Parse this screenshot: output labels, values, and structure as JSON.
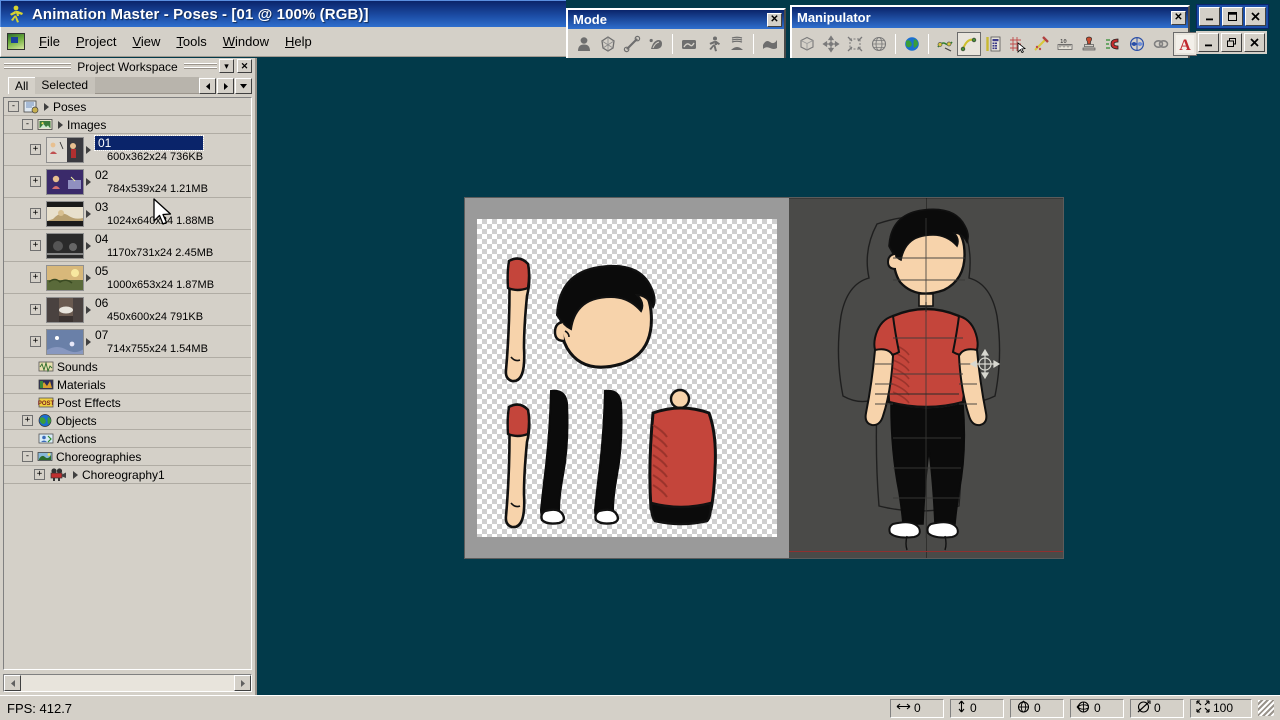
{
  "app": {
    "title": "Animation Master - Poses - [01 @ 100% (RGB)]",
    "logo_icon": "running-man-icon"
  },
  "menu": {
    "app_icon": "document-image-icon",
    "items": [
      {
        "label": "File",
        "mnemonic": "F"
      },
      {
        "label": "Project",
        "mnemonic": "P"
      },
      {
        "label": "View",
        "mnemonic": "V"
      },
      {
        "label": "Tools",
        "mnemonic": "T"
      },
      {
        "label": "Window",
        "mnemonic": "W"
      },
      {
        "label": "Help",
        "mnemonic": "H"
      }
    ]
  },
  "mode_palette": {
    "title": "Mode",
    "close_label": "✕",
    "buttons": [
      {
        "name": "modeling-mode-icon",
        "title": "Modeling"
      },
      {
        "name": "mesh-mode-icon",
        "title": "Mesh"
      },
      {
        "name": "bone-mode-icon",
        "title": "Bones"
      },
      {
        "name": "muscle-mode-icon",
        "title": "Muscle"
      },
      {
        "name": "action-mode-icon",
        "title": "Action"
      },
      {
        "name": "walk-mode-icon",
        "title": "Walk"
      },
      {
        "name": "spring-mode-icon",
        "title": "Dynamics"
      },
      {
        "name": "choreography-mode-icon",
        "title": "Choreography"
      }
    ]
  },
  "manipulator_palette": {
    "title": "Manipulator",
    "close_label": "✕",
    "buttons": [
      {
        "name": "bounding-box-icon",
        "selected": false
      },
      {
        "name": "translate-icon",
        "selected": false
      },
      {
        "name": "scale-icon",
        "selected": false
      },
      {
        "name": "rotate-globe-icon",
        "selected": false
      },
      {
        "name": "world-globe-icon",
        "selected": false
      },
      {
        "name": "group-edit-icon",
        "selected": false
      },
      {
        "name": "spline-edit-icon",
        "selected": true
      },
      {
        "name": "properties-icon",
        "selected": false
      },
      {
        "name": "grid-snap-icon",
        "selected": false
      },
      {
        "name": "magnet-snap-icon",
        "selected": false
      },
      {
        "name": "ruler-icon",
        "selected": false
      },
      {
        "name": "stamp-icon",
        "selected": false
      },
      {
        "name": "magnet-icon",
        "selected": false
      },
      {
        "name": "mirror-icon",
        "selected": false
      },
      {
        "name": "link-icon",
        "selected": false
      },
      {
        "name": "text-tool-icon",
        "selected": false
      }
    ]
  },
  "window_controls": {
    "outer": [
      {
        "name": "minimize-button",
        "glyph": "minimize"
      },
      {
        "name": "maximize-button",
        "glyph": "maximize"
      },
      {
        "name": "close-button",
        "glyph": "close"
      }
    ],
    "inner": [
      {
        "name": "minimize-button",
        "glyph": "minimize"
      },
      {
        "name": "restore-button",
        "glyph": "restore"
      },
      {
        "name": "close-button",
        "glyph": "close"
      }
    ]
  },
  "workspace": {
    "title": "Project Workspace",
    "menu_button_label": "▾",
    "close_button_label": "✕",
    "tabs": [
      {
        "label": "All",
        "active": true
      },
      {
        "label": "Selected",
        "active": false
      }
    ],
    "tab_nav": [
      {
        "name": "tab-prev-button",
        "glyph": "◄"
      },
      {
        "name": "tab-next-button",
        "glyph": "►"
      },
      {
        "name": "tab-menu-button",
        "glyph": "▼"
      }
    ],
    "tree": [
      {
        "label": "Poses",
        "indent": 0,
        "expander": "-",
        "arrow": true,
        "icon": "poses-folder-icon",
        "type": "folder",
        "selected": false
      },
      {
        "label": "Images",
        "indent": 1,
        "expander": "-",
        "arrow": true,
        "icon": "images-folder-icon",
        "type": "folder",
        "selected": false
      },
      {
        "label": "01",
        "indent": 2,
        "expander": "+",
        "arrow": true,
        "type": "image",
        "selected": true,
        "size": "600x362x24 736KB",
        "thumb": "thumb-01"
      },
      {
        "label": "02",
        "indent": 2,
        "expander": "+",
        "arrow": true,
        "type": "image",
        "selected": false,
        "size": "784x539x24 1.21MB",
        "thumb": "thumb-02"
      },
      {
        "label": "03",
        "indent": 2,
        "expander": "+",
        "arrow": true,
        "type": "image",
        "selected": false,
        "size": "1024x640x24 1.88MB",
        "thumb": "thumb-03"
      },
      {
        "label": "04",
        "indent": 2,
        "expander": "+",
        "arrow": true,
        "type": "image",
        "selected": false,
        "size": "1170x731x24 2.45MB",
        "thumb": "thumb-04"
      },
      {
        "label": "05",
        "indent": 2,
        "expander": "+",
        "arrow": true,
        "type": "image",
        "selected": false,
        "size": "1000x653x24 1.87MB",
        "thumb": "thumb-05"
      },
      {
        "label": "06",
        "indent": 2,
        "expander": "+",
        "arrow": true,
        "type": "image",
        "selected": false,
        "size": "450x600x24 791KB",
        "thumb": "thumb-06"
      },
      {
        "label": "07",
        "indent": 2,
        "expander": "+",
        "arrow": true,
        "type": "image",
        "selected": false,
        "size": "714x755x24 1.54MB",
        "thumb": "thumb-07"
      },
      {
        "label": "Sounds",
        "indent": 1,
        "expander": "",
        "arrow": false,
        "icon": "sounds-icon",
        "type": "folder",
        "selected": false
      },
      {
        "label": "Materials",
        "indent": 1,
        "expander": "",
        "arrow": false,
        "icon": "materials-icon",
        "type": "folder",
        "selected": false
      },
      {
        "label": "Post Effects",
        "indent": 1,
        "expander": "",
        "arrow": false,
        "icon": "post-effects-icon",
        "type": "folder",
        "selected": false
      },
      {
        "label": "Objects",
        "indent": 1,
        "expander": "+",
        "arrow": false,
        "icon": "objects-globe-icon",
        "type": "folder",
        "selected": false
      },
      {
        "label": "Actions",
        "indent": 1,
        "expander": "",
        "arrow": false,
        "icon": "actions-icon",
        "type": "folder",
        "selected": false
      },
      {
        "label": "Choreographies",
        "indent": 1,
        "expander": "-",
        "arrow": false,
        "icon": "choreographies-icon",
        "type": "folder",
        "selected": false
      },
      {
        "label": "Choreography1",
        "indent": 2,
        "expander": "+",
        "arrow": true,
        "icon": "camera-icon",
        "type": "folder",
        "selected": false
      }
    ],
    "hscroll": {
      "left_arrow": "◄",
      "right_arrow": "►"
    }
  },
  "document_window": {
    "zoom_label": "100%",
    "color_mode": "RGB",
    "left_canvas": {
      "name": "image-canvas-01",
      "background": "transparency-checkerboard",
      "parts": [
        "right-arm",
        "head",
        "left-arm",
        "right-leg",
        "left-leg",
        "torso"
      ]
    },
    "right_viewport": {
      "name": "model-viewport",
      "background": "#4a4a48",
      "subject": "rigged-character"
    }
  },
  "statusbar": {
    "fps_label": "FPS: 412.7",
    "fields": [
      {
        "name": "x-position-field",
        "icon": "horizontal-arrows-icon",
        "value": "0"
      },
      {
        "name": "y-position-field",
        "icon": "vertical-arrows-icon",
        "value": "0"
      },
      {
        "name": "rotate-x-field",
        "icon": "rotate-x-icon",
        "value": "0"
      },
      {
        "name": "rotate-y-field",
        "icon": "rotate-y-icon",
        "value": "0"
      },
      {
        "name": "rotate-z-field",
        "icon": "rotate-z-icon",
        "value": "0"
      },
      {
        "name": "scale-field",
        "icon": "scale-arrows-icon",
        "value": "100"
      }
    ],
    "resize_grip": "resize-grip-icon"
  },
  "colors": {
    "workspace_bg": "#023a4a",
    "chrome": "#d4d0c8",
    "titlebar_start": "#0a246a",
    "titlebar_end": "#2f6fce",
    "selection": "#0a246a",
    "skin": "#f7d0a8",
    "shirt": "#c4453b",
    "hair": "#000000",
    "viewport_bg": "#4a4a48"
  }
}
